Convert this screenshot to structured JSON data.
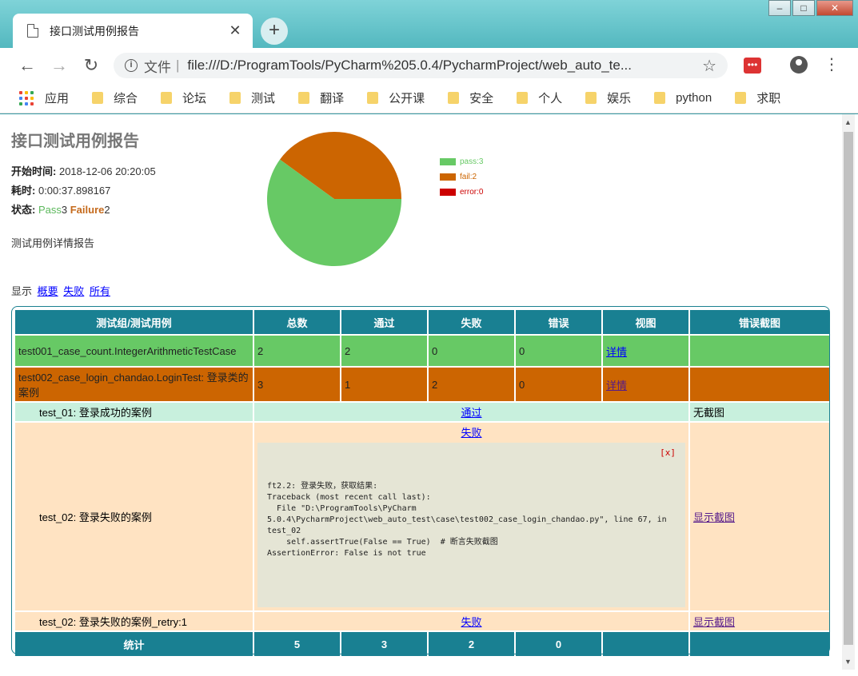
{
  "browser": {
    "tab_title": "接口测试用例报告",
    "tab_close": "✕",
    "new_tab": "+",
    "win_min": "–",
    "win_max": "□",
    "win_close": "✕",
    "back": "←",
    "forward": "→",
    "reload": "↻",
    "info_icon": "i",
    "url_label": "文件",
    "url_sep": "|",
    "url": "file:///D:/ProgramTools/PyCharm%205.0.4/PycharmProject/web_auto_te...",
    "star": "☆",
    "ext_label": "•••",
    "menu": "⋮"
  },
  "bookmarks": {
    "apps": "应用",
    "items": [
      "综合",
      "论坛",
      "测试",
      "翻译",
      "公开课",
      "安全",
      "个人",
      "娱乐",
      "python",
      "求职"
    ]
  },
  "report": {
    "title": "接口测试用例报告",
    "start_label": "开始时间:",
    "start_value": "2018-12-06 20:20:05",
    "duration_label": "耗时:",
    "duration_value": "0:00:37.898167",
    "status_label": "状态:",
    "status_pass_word": "Pass",
    "status_pass_count": "3",
    "status_fail_word": "Failure",
    "status_fail_count": "2",
    "description": "测试用例详情报告",
    "filter_label": "显示",
    "filter_summary": "概要",
    "filter_failed": "失败",
    "filter_all": "所有"
  },
  "chart_data": {
    "type": "pie",
    "slices": [
      {
        "label": "pass:3",
        "value": 3,
        "color": "#67c965"
      },
      {
        "label": "fail:2",
        "value": 2,
        "color": "#cc6501"
      },
      {
        "label": "error:0",
        "value": 0,
        "color": "#cc0000"
      }
    ]
  },
  "table": {
    "headers": [
      "测试组/测试用例",
      "总数",
      "通过",
      "失败",
      "错误",
      "视图",
      "错误截图"
    ],
    "groups": [
      {
        "name": "test001_case_count.IntegerArithmeticTestCase",
        "total": "2",
        "pass": "2",
        "fail": "0",
        "error": "0",
        "view": "详情"
      },
      {
        "name": "test002_case_login_chandao.LoginTest: 登录类的案例",
        "total": "3",
        "pass": "1",
        "fail": "2",
        "error": "0",
        "view": "详情"
      }
    ],
    "cases": [
      {
        "name": "test_01: 登录成功的案例",
        "result": "通过",
        "screenshot": "无截图"
      },
      {
        "name": "test_02: 登录失败的案例",
        "result": "失败",
        "screenshot": "显示截图",
        "close": "[x]",
        "traceback": "ft2.2: 登录失败，获取结果:\nTraceback (most recent call last):\n  File \"D:\\ProgramTools\\PyCharm\n5.0.4\\PycharmProject\\web_auto_test\\case\\test002_case_login_chandao.py\", line 67, in\ntest_02\n    self.assertTrue(False == True)  # 断言失败截图\nAssertionError: False is not true"
      },
      {
        "name": "test_02: 登录失败的案例_retry:1",
        "result": "失败",
        "screenshot": "显示截图"
      }
    ],
    "footer": {
      "label": "统计",
      "total": "5",
      "pass": "3",
      "fail": "2",
      "error": "0"
    }
  }
}
